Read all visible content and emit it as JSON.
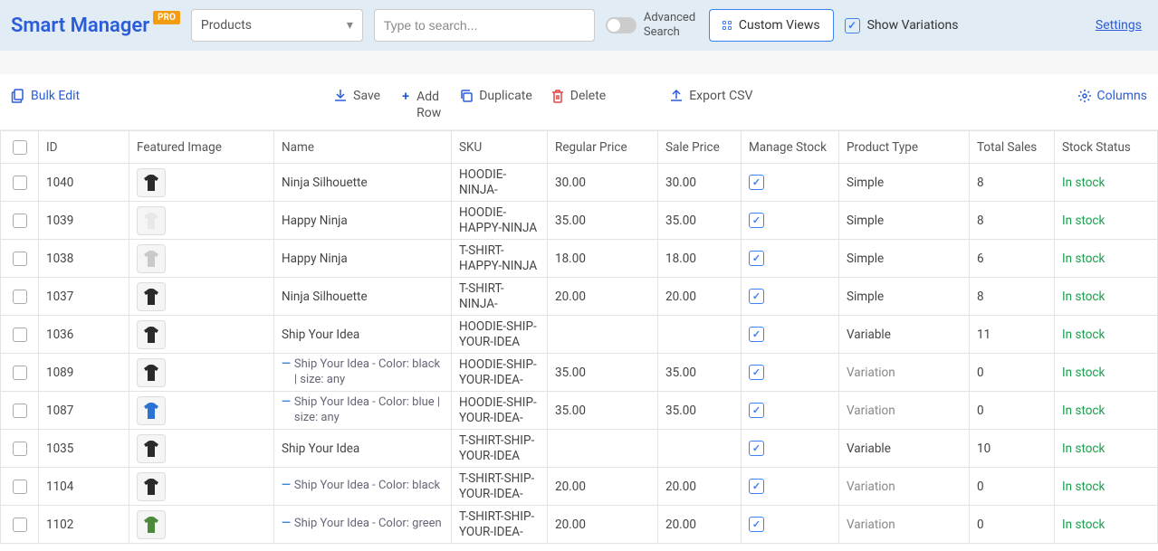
{
  "header": {
    "logo_text": "Smart Manager",
    "pro_badge": "PRO",
    "entity_dropdown": "Products",
    "search_placeholder": "Type to search...",
    "advanced_search_label": "Advanced Search",
    "custom_views_label": "Custom Views",
    "show_variations_label": "Show Variations",
    "show_variations_checked": true,
    "settings_link": "Settings"
  },
  "toolbar": {
    "bulk_edit": "Bulk Edit",
    "save": "Save",
    "add_row": "Add Row",
    "duplicate": "Duplicate",
    "delete": "Delete",
    "export_csv": "Export CSV",
    "columns": "Columns"
  },
  "columns": {
    "id": "ID",
    "featured_image": "Featured Image",
    "name": "Name",
    "sku": "SKU",
    "regular_price": "Regular Price",
    "sale_price": "Sale Price",
    "manage_stock": "Manage Stock",
    "product_type": "Product Type",
    "total_sales": "Total Sales",
    "stock_status": "Stock Status"
  },
  "rows": [
    {
      "id": "1040",
      "thumb": "black",
      "name": "Ninja Silhouette",
      "sku": "HOODIE-NINJA-",
      "rprice": "30.00",
      "sprice": "30.00",
      "mstock": true,
      "ptype": "Simple",
      "variation": false,
      "sales": "8",
      "stock": "In stock"
    },
    {
      "id": "1039",
      "thumb": "white",
      "name": "Happy Ninja",
      "sku": "HOODIE-HAPPY-NINJA",
      "rprice": "35.00",
      "sprice": "35.00",
      "mstock": true,
      "ptype": "Simple",
      "variation": false,
      "sales": "8",
      "stock": "In stock"
    },
    {
      "id": "1038",
      "thumb": "gray",
      "name": "Happy Ninja",
      "sku": "T-SHIRT-HAPPY-NINJA",
      "rprice": "18.00",
      "sprice": "18.00",
      "mstock": true,
      "ptype": "Simple",
      "variation": false,
      "sales": "6",
      "stock": "In stock"
    },
    {
      "id": "1037",
      "thumb": "black",
      "name": "Ninja Silhouette",
      "sku": "T-SHIRT-NINJA-",
      "rprice": "20.00",
      "sprice": "20.00",
      "mstock": true,
      "ptype": "Simple",
      "variation": false,
      "sales": "8",
      "stock": "In stock"
    },
    {
      "id": "1036",
      "thumb": "black",
      "name": "Ship Your Idea",
      "sku": "HOODIE-SHIP-YOUR-IDEA",
      "rprice": "",
      "sprice": "",
      "mstock": true,
      "ptype": "Variable",
      "variation": false,
      "sales": "11",
      "stock": "In stock"
    },
    {
      "id": "1089",
      "thumb": "black",
      "name": "Ship Your Idea - Color: black | size: any",
      "sku": "HOODIE-SHIP-YOUR-IDEA-",
      "rprice": "35.00",
      "sprice": "35.00",
      "mstock": true,
      "ptype": "Variation",
      "variation": true,
      "sales": "0",
      "stock": "In stock"
    },
    {
      "id": "1087",
      "thumb": "blue",
      "name": "Ship Your Idea - Color: blue | size: any",
      "sku": "HOODIE-SHIP-YOUR-IDEA-",
      "rprice": "35.00",
      "sprice": "35.00",
      "mstock": true,
      "ptype": "Variation",
      "variation": true,
      "sales": "0",
      "stock": "In stock"
    },
    {
      "id": "1035",
      "thumb": "black",
      "name": "Ship Your Idea",
      "sku": "T-SHIRT-SHIP-YOUR-IDEA",
      "rprice": "",
      "sprice": "",
      "mstock": true,
      "ptype": "Variable",
      "variation": false,
      "sales": "10",
      "stock": "In stock"
    },
    {
      "id": "1104",
      "thumb": "black",
      "name": "Ship Your Idea - Color: black",
      "sku": "T-SHIRT-SHIP-YOUR-IDEA-",
      "rprice": "20.00",
      "sprice": "20.00",
      "mstock": true,
      "ptype": "Variation",
      "variation": true,
      "sales": "0",
      "stock": "In stock"
    },
    {
      "id": "1102",
      "thumb": "green",
      "name": "Ship Your Idea - Color: green",
      "sku": "T-SHIRT-SHIP-YOUR-IDEA-",
      "rprice": "20.00",
      "sprice": "20.00",
      "mstock": true,
      "ptype": "Variation",
      "variation": true,
      "sales": "0",
      "stock": "In stock"
    }
  ],
  "thumb_colors": {
    "black": "#2a2a2a",
    "white": "#e8e8e8",
    "gray": "#c9c9c9",
    "blue": "#2a72d4",
    "green": "#4a8a3a"
  }
}
